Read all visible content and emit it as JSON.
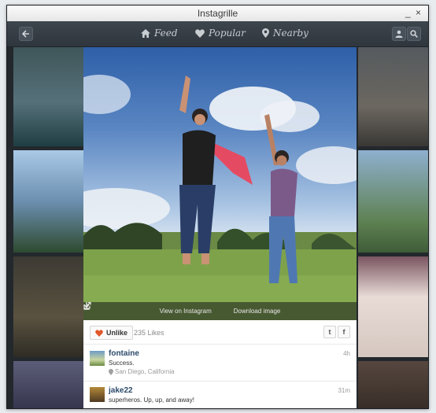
{
  "window": {
    "title": "Instagrille",
    "minimize_glyph": "_",
    "close_glyph": "×"
  },
  "toolbar": {
    "back_icon": "back-arrow-icon",
    "nav": [
      {
        "label": "Feed",
        "icon": "home-icon"
      },
      {
        "label": "Popular",
        "icon": "heart-icon"
      },
      {
        "label": "Nearby",
        "icon": "location-pin-icon"
      }
    ],
    "user_icon": "user-icon",
    "search_icon": "search-icon"
  },
  "photo_actions": {
    "view_label": "View on Instagram",
    "download_label": "Download image"
  },
  "post": {
    "unlike_label": "Unlike",
    "likes_text": "235 Likes",
    "share_twitter": "t",
    "share_facebook": "f"
  },
  "comments": [
    {
      "user": "fontaine",
      "text": "Success.",
      "location": "San Diego, California",
      "time": "4h"
    },
    {
      "user": "jake22",
      "text": "superheros. Up, up, and away!",
      "time": "31m"
    }
  ],
  "colors": {
    "heart": "#e2572b",
    "toolbar": "#353c43",
    "username": "#2c4a6a"
  }
}
